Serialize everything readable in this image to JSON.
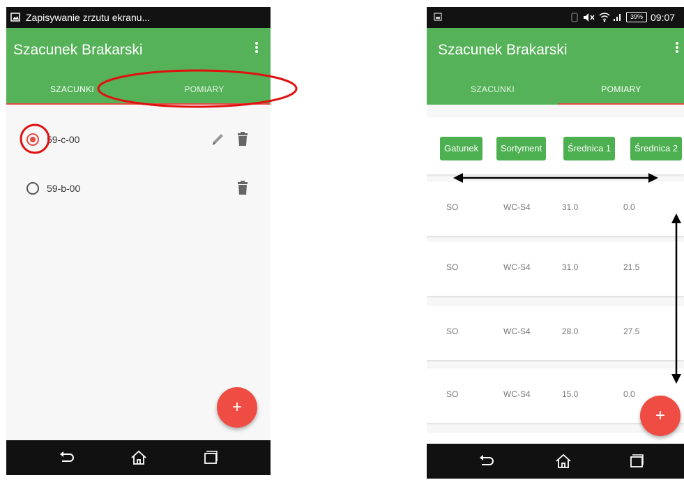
{
  "left_screen": {
    "status_text": "Zapisywanie zrzutu ekranu...",
    "app_title": "Szacunek Brakarski",
    "tabs": [
      {
        "label": "SZACUNKI",
        "active": true
      },
      {
        "label": "POMIARY",
        "active": false
      }
    ],
    "items": [
      {
        "label": "59-c-00",
        "selected": true,
        "has_edit": true
      },
      {
        "label": "59-b-00",
        "selected": false,
        "has_edit": false
      }
    ],
    "fab_label": "+"
  },
  "right_screen": {
    "status": {
      "battery": "39%",
      "time": "09:07"
    },
    "app_title": "Szacunek Brakarski",
    "tabs": [
      {
        "label": "SZACUNKI",
        "active": false
      },
      {
        "label": "POMIARY",
        "active": true
      }
    ],
    "columns": [
      "Gatunek",
      "Sortyment",
      "Średnica 1",
      "Średnica 2"
    ],
    "rows": [
      [
        "SO",
        "WC-S4",
        "31.0",
        "0.0"
      ],
      [
        "SO",
        "WC-S4",
        "31.0",
        "21.5"
      ],
      [
        "SO",
        "WC-S4",
        "28.0",
        "27.5"
      ],
      [
        "SO",
        "WC-S4",
        "15.0",
        "0.0"
      ]
    ],
    "fab_label": "+"
  },
  "colors": {
    "app_bar": "#55b258",
    "accent": "#e34b43",
    "chip": "#4caf50",
    "fab": "#ef4c44",
    "annotation_red": "#e01010"
  }
}
